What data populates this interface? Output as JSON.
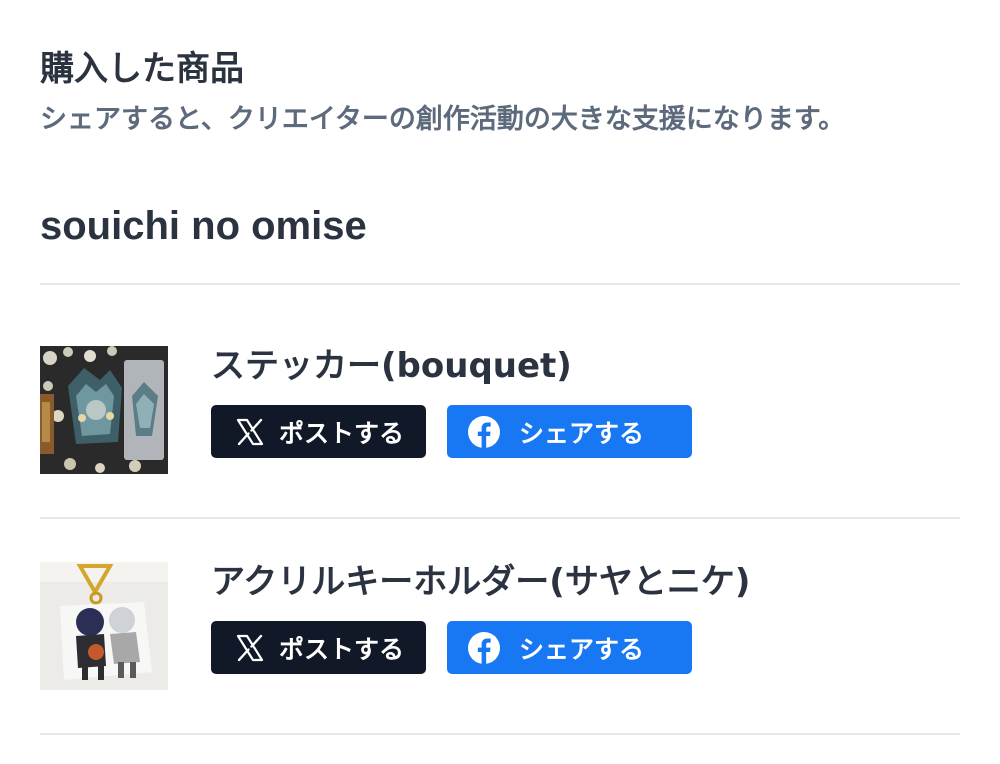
{
  "header": {
    "title": "購入した商品",
    "subtitle": "シェアすると、クリエイターの創作活動の大きな支援になります。"
  },
  "shop": {
    "name": "souichi no omise"
  },
  "items": [
    {
      "name": "ステッカー(bouquet)",
      "post_label": "ポストする",
      "share_label": "シェアする"
    },
    {
      "name": "アクリルキーホルダー(サヤとニケ)",
      "post_label": "ポストする",
      "share_label": "シェアする"
    }
  ],
  "icons": {
    "x": "x-logo-icon",
    "facebook": "facebook-logo-icon"
  },
  "colors": {
    "x_button": "#111827",
    "facebook_button": "#1877f2",
    "divider": "#e5e7eb"
  }
}
